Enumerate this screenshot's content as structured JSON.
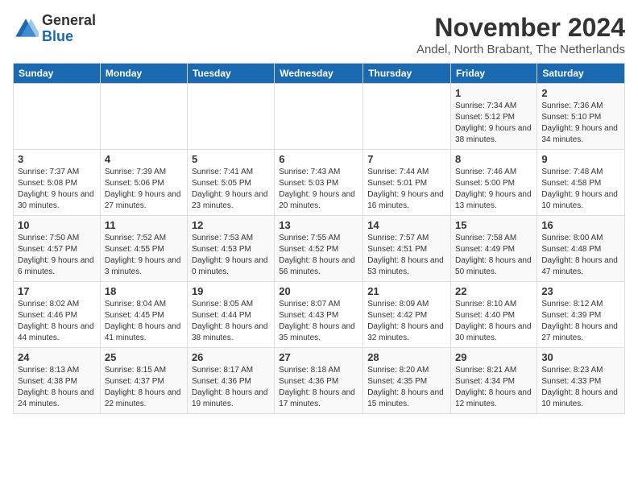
{
  "logo": {
    "general": "General",
    "blue": "Blue"
  },
  "header": {
    "month": "November 2024",
    "location": "Andel, North Brabant, The Netherlands"
  },
  "days_of_week": [
    "Sunday",
    "Monday",
    "Tuesday",
    "Wednesday",
    "Thursday",
    "Friday",
    "Saturday"
  ],
  "weeks": [
    [
      {
        "day": "",
        "info": ""
      },
      {
        "day": "",
        "info": ""
      },
      {
        "day": "",
        "info": ""
      },
      {
        "day": "",
        "info": ""
      },
      {
        "day": "",
        "info": ""
      },
      {
        "day": "1",
        "info": "Sunrise: 7:34 AM\nSunset: 5:12 PM\nDaylight: 9 hours and 38 minutes."
      },
      {
        "day": "2",
        "info": "Sunrise: 7:36 AM\nSunset: 5:10 PM\nDaylight: 9 hours and 34 minutes."
      }
    ],
    [
      {
        "day": "3",
        "info": "Sunrise: 7:37 AM\nSunset: 5:08 PM\nDaylight: 9 hours and 30 minutes."
      },
      {
        "day": "4",
        "info": "Sunrise: 7:39 AM\nSunset: 5:06 PM\nDaylight: 9 hours and 27 minutes."
      },
      {
        "day": "5",
        "info": "Sunrise: 7:41 AM\nSunset: 5:05 PM\nDaylight: 9 hours and 23 minutes."
      },
      {
        "day": "6",
        "info": "Sunrise: 7:43 AM\nSunset: 5:03 PM\nDaylight: 9 hours and 20 minutes."
      },
      {
        "day": "7",
        "info": "Sunrise: 7:44 AM\nSunset: 5:01 PM\nDaylight: 9 hours and 16 minutes."
      },
      {
        "day": "8",
        "info": "Sunrise: 7:46 AM\nSunset: 5:00 PM\nDaylight: 9 hours and 13 minutes."
      },
      {
        "day": "9",
        "info": "Sunrise: 7:48 AM\nSunset: 4:58 PM\nDaylight: 9 hours and 10 minutes."
      }
    ],
    [
      {
        "day": "10",
        "info": "Sunrise: 7:50 AM\nSunset: 4:57 PM\nDaylight: 9 hours and 6 minutes."
      },
      {
        "day": "11",
        "info": "Sunrise: 7:52 AM\nSunset: 4:55 PM\nDaylight: 9 hours and 3 minutes."
      },
      {
        "day": "12",
        "info": "Sunrise: 7:53 AM\nSunset: 4:53 PM\nDaylight: 9 hours and 0 minutes."
      },
      {
        "day": "13",
        "info": "Sunrise: 7:55 AM\nSunset: 4:52 PM\nDaylight: 8 hours and 56 minutes."
      },
      {
        "day": "14",
        "info": "Sunrise: 7:57 AM\nSunset: 4:51 PM\nDaylight: 8 hours and 53 minutes."
      },
      {
        "day": "15",
        "info": "Sunrise: 7:58 AM\nSunset: 4:49 PM\nDaylight: 8 hours and 50 minutes."
      },
      {
        "day": "16",
        "info": "Sunrise: 8:00 AM\nSunset: 4:48 PM\nDaylight: 8 hours and 47 minutes."
      }
    ],
    [
      {
        "day": "17",
        "info": "Sunrise: 8:02 AM\nSunset: 4:46 PM\nDaylight: 8 hours and 44 minutes."
      },
      {
        "day": "18",
        "info": "Sunrise: 8:04 AM\nSunset: 4:45 PM\nDaylight: 8 hours and 41 minutes."
      },
      {
        "day": "19",
        "info": "Sunrise: 8:05 AM\nSunset: 4:44 PM\nDaylight: 8 hours and 38 minutes."
      },
      {
        "day": "20",
        "info": "Sunrise: 8:07 AM\nSunset: 4:43 PM\nDaylight: 8 hours and 35 minutes."
      },
      {
        "day": "21",
        "info": "Sunrise: 8:09 AM\nSunset: 4:42 PM\nDaylight: 8 hours and 32 minutes."
      },
      {
        "day": "22",
        "info": "Sunrise: 8:10 AM\nSunset: 4:40 PM\nDaylight: 8 hours and 30 minutes."
      },
      {
        "day": "23",
        "info": "Sunrise: 8:12 AM\nSunset: 4:39 PM\nDaylight: 8 hours and 27 minutes."
      }
    ],
    [
      {
        "day": "24",
        "info": "Sunrise: 8:13 AM\nSunset: 4:38 PM\nDaylight: 8 hours and 24 minutes."
      },
      {
        "day": "25",
        "info": "Sunrise: 8:15 AM\nSunset: 4:37 PM\nDaylight: 8 hours and 22 minutes."
      },
      {
        "day": "26",
        "info": "Sunrise: 8:17 AM\nSunset: 4:36 PM\nDaylight: 8 hours and 19 minutes."
      },
      {
        "day": "27",
        "info": "Sunrise: 8:18 AM\nSunset: 4:36 PM\nDaylight: 8 hours and 17 minutes."
      },
      {
        "day": "28",
        "info": "Sunrise: 8:20 AM\nSunset: 4:35 PM\nDaylight: 8 hours and 15 minutes."
      },
      {
        "day": "29",
        "info": "Sunrise: 8:21 AM\nSunset: 4:34 PM\nDaylight: 8 hours and 12 minutes."
      },
      {
        "day": "30",
        "info": "Sunrise: 8:23 AM\nSunset: 4:33 PM\nDaylight: 8 hours and 10 minutes."
      }
    ]
  ]
}
